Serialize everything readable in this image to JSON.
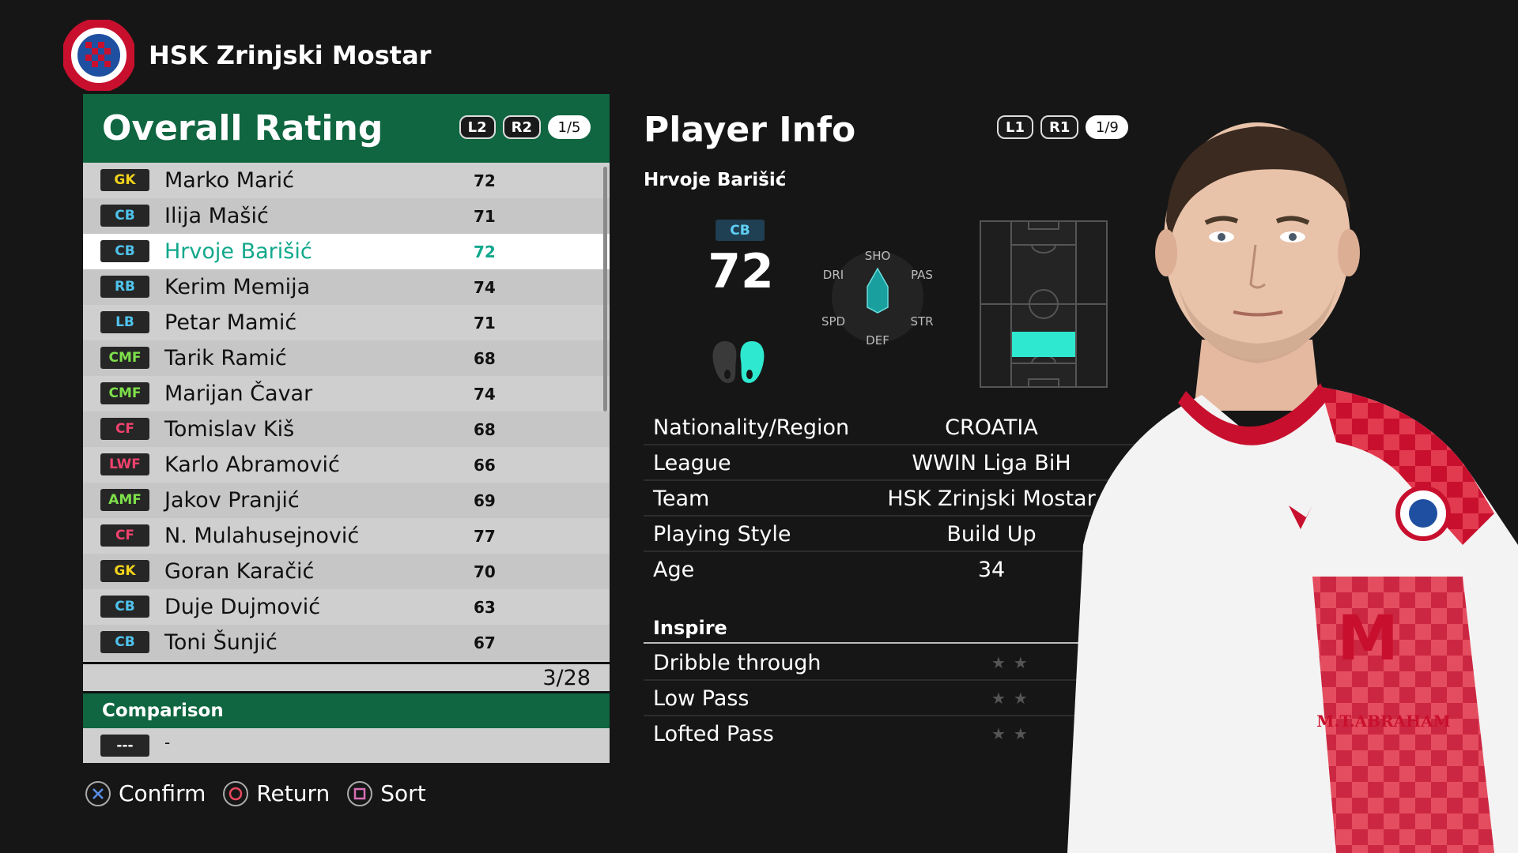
{
  "club": {
    "name": "HSK Zrinjski Mostar",
    "logo_icon": "club-crest-icon"
  },
  "overall_panel": {
    "title": "Overall Rating",
    "buttons": [
      "L2",
      "R2"
    ],
    "page": "1/5",
    "players": [
      {
        "pos": "GK",
        "pos_color": "#f2d21b",
        "name": "Marko Marić",
        "rating": "72"
      },
      {
        "pos": "CB",
        "pos_color": "#4fc3ec",
        "name": "Ilija Mašić",
        "rating": "71"
      },
      {
        "pos": "CB",
        "pos_color": "#4fc3ec",
        "name": "Hrvoje Barišić",
        "rating": "72",
        "selected": true
      },
      {
        "pos": "RB",
        "pos_color": "#4fc3ec",
        "name": "Kerim Memija",
        "rating": "74"
      },
      {
        "pos": "LB",
        "pos_color": "#4fc3ec",
        "name": "Petar Mamić",
        "rating": "71"
      },
      {
        "pos": "CMF",
        "pos_color": "#7ee04a",
        "name": "Tarik Ramić",
        "rating": "68"
      },
      {
        "pos": "CMF",
        "pos_color": "#7ee04a",
        "name": "Marijan Čavar",
        "rating": "74"
      },
      {
        "pos": "CF",
        "pos_color": "#f0426e",
        "name": "Tomislav Kiš",
        "rating": "68"
      },
      {
        "pos": "LWF",
        "pos_color": "#f0426e",
        "name": "Karlo Abramović",
        "rating": "66"
      },
      {
        "pos": "AMF",
        "pos_color": "#7ee04a",
        "name": "Jakov Pranjić",
        "rating": "69"
      },
      {
        "pos": "CF",
        "pos_color": "#f0426e",
        "name": "N. Mulahusejnović",
        "rating": "77"
      },
      {
        "pos": "GK",
        "pos_color": "#f2d21b",
        "name": "Goran Karačić",
        "rating": "70"
      },
      {
        "pos": "CB",
        "pos_color": "#4fc3ec",
        "name": "Duje Dujmović",
        "rating": "63"
      },
      {
        "pos": "CB",
        "pos_color": "#4fc3ec",
        "name": "Toni Šunjić",
        "rating": "67"
      }
    ],
    "count": "3/28",
    "comparison_title": "Comparison",
    "comparison_badge": "---",
    "comparison_value": "-"
  },
  "player_info": {
    "title": "Player Info",
    "buttons": [
      "L1",
      "R1"
    ],
    "page": "1/9",
    "name": "Hrvoje Barišić",
    "position": "CB",
    "rating": "72",
    "radar_labels": {
      "sho": "SHO",
      "pas": "PAS",
      "str": "STR",
      "def": "DEF",
      "spd": "SPD",
      "dri": "DRI"
    },
    "preferred_foot": "Right",
    "details": [
      {
        "label": "Nationality/Region",
        "value": "CROATIA"
      },
      {
        "label": "League",
        "value": "WWIN Liga BiH"
      },
      {
        "label": "Team",
        "value": "HSK Zrinjski Mostar"
      },
      {
        "label": "Playing Style",
        "value": "Build Up"
      },
      {
        "label": "Age",
        "value": "34"
      }
    ],
    "inspire_title": "Inspire",
    "inspire": [
      {
        "label": "Dribble through",
        "stars_filled": 0
      },
      {
        "label": "Low Pass",
        "stars_filled": 0
      },
      {
        "label": "Lofted Pass",
        "stars_filled": 0
      }
    ]
  },
  "footer": [
    {
      "icon": "cross-button-icon",
      "label": "Confirm"
    },
    {
      "icon": "circle-button-icon",
      "label": "Return"
    },
    {
      "icon": "square-button-icon",
      "label": "Sort"
    }
  ],
  "colors": {
    "green": "#0f6640",
    "teal": "#11a88c",
    "cyan": "#2fe8d0"
  }
}
